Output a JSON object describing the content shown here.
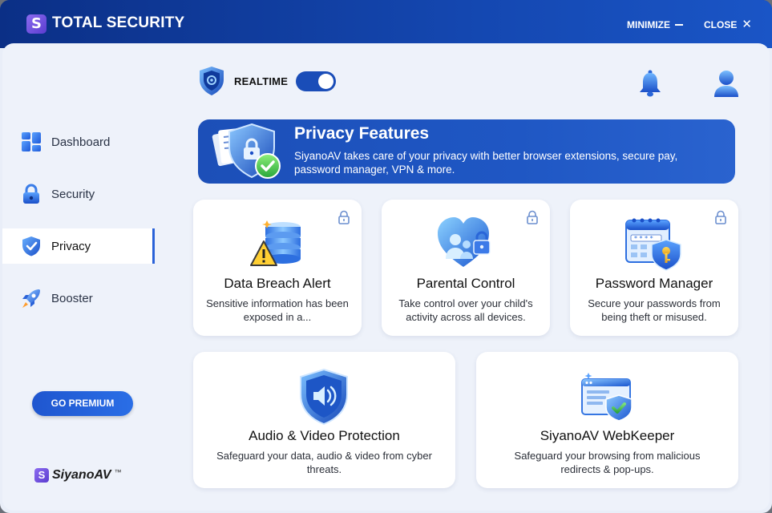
{
  "window": {
    "title": "TOTAL SECURITY",
    "logo_letter": "S",
    "minimize_label": "MINIMIZE",
    "close_label": "CLOSE"
  },
  "sidebar": {
    "items": [
      {
        "label": "Dashboard",
        "icon": "dashboard-icon",
        "active": false
      },
      {
        "label": "Security",
        "icon": "lock-icon",
        "active": false
      },
      {
        "label": "Privacy",
        "icon": "shield-icon",
        "active": true
      },
      {
        "label": "Booster",
        "icon": "rocket-icon",
        "active": false
      }
    ],
    "premium_label": "GO PREMIUM",
    "brand_letter": "S",
    "brand_name": "SiyanoAV",
    "brand_mark": "™"
  },
  "header": {
    "realtime_label": "REALTIME",
    "realtime_on": true
  },
  "banner": {
    "title": "Privacy Features",
    "description": "SiyanoAV takes care of your privacy with better browser extensions, secure pay, password manager, VPN & more."
  },
  "cards": [
    {
      "title": "Data Breach Alert",
      "description": "Sensitive information has been exposed in a...",
      "locked": true,
      "icon": "data-breach-icon"
    },
    {
      "title": "Parental Control",
      "description": "Take control over your child's activity across all devices.",
      "locked": true,
      "icon": "parental-control-icon"
    },
    {
      "title": "Password Manager",
      "description": "Secure your passwords from being theft or misused.",
      "locked": true,
      "icon": "password-manager-icon"
    },
    {
      "title": "Audio & Video Protection",
      "description": "Safeguard your data, audio & video from cyber threats.",
      "locked": false,
      "icon": "audio-video-shield-icon"
    },
    {
      "title": "SiyanoAV WebKeeper",
      "description": "Safeguard your browsing from malicious redirects & pop-ups.",
      "locked": false,
      "icon": "webkeeper-icon"
    }
  ],
  "colors": {
    "accent": "#1f56cf",
    "titlebar": "#0b2f86",
    "panel_bg": "#eef2fa",
    "banner": "#1c4fb8"
  }
}
